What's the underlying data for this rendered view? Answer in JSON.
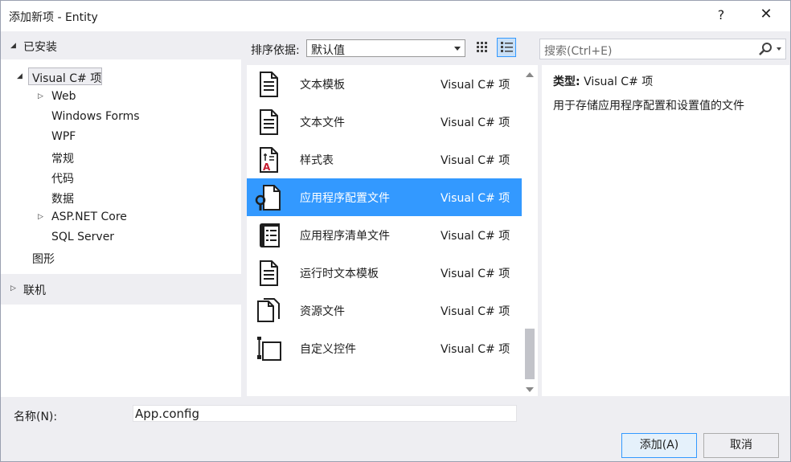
{
  "window": {
    "title": "添加新项 - Entity",
    "help_label": "?",
    "close_label": "✕"
  },
  "tree": {
    "installed_label": "已安装",
    "selected_label": "Visual C# 项",
    "children": [
      {
        "label": "Web",
        "expandable": true
      },
      {
        "label": "Windows Forms",
        "expandable": false
      },
      {
        "label": "WPF",
        "expandable": false
      },
      {
        "label": "常规",
        "expandable": false
      },
      {
        "label": "代码",
        "expandable": false
      },
      {
        "label": "数据",
        "expandable": false
      },
      {
        "label": "ASP.NET Core",
        "expandable": true
      },
      {
        "label": "SQL Server",
        "expandable": false
      }
    ],
    "graphics_label": "图形",
    "online_label": "联机"
  },
  "toolbar": {
    "sort_label": "排序依据:",
    "sort_value": "默认值",
    "search_placeholder": "搜索(Ctrl+E)"
  },
  "items": [
    {
      "name": "文本模板",
      "lang": "Visual C# 项",
      "icon": "text-template-icon"
    },
    {
      "name": "文本文件",
      "lang": "Visual C# 项",
      "icon": "text-file-icon"
    },
    {
      "name": "样式表",
      "lang": "Visual C# 项",
      "icon": "stylesheet-icon"
    },
    {
      "name": "应用程序配置文件",
      "lang": "Visual C# 项",
      "icon": "config-file-icon",
      "selected": true
    },
    {
      "name": "应用程序清单文件",
      "lang": "Visual C# 项",
      "icon": "manifest-file-icon"
    },
    {
      "name": "运行时文本模板",
      "lang": "Visual C# 项",
      "icon": "runtime-template-icon"
    },
    {
      "name": "资源文件",
      "lang": "Visual C# 项",
      "icon": "resource-file-icon"
    },
    {
      "name": "自定义控件",
      "lang": "Visual C# 项",
      "icon": "custom-control-icon"
    }
  ],
  "detail": {
    "type_label": "类型:",
    "type_value": "Visual C# 项",
    "description": "用于存储应用程序配置和设置值的文件"
  },
  "bottom": {
    "name_label": "名称(N):",
    "name_value": "App.config",
    "add_label": "添加(A)",
    "cancel_label": "取消"
  },
  "colors": {
    "selection": "#3399ff",
    "chrome": "#eeeef2",
    "panel": "#ffffff"
  }
}
